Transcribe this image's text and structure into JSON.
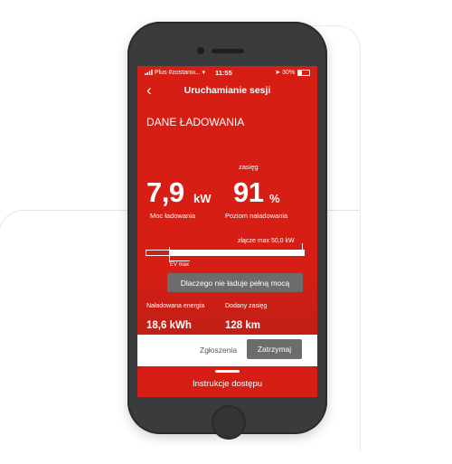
{
  "status_bar": {
    "carrier": "Plus #zostanw...",
    "time": "11:55",
    "battery": "30%"
  },
  "nav": {
    "back_icon": "chevron-left",
    "title": "Uruchamianie sesji"
  },
  "section_title": "DANE ŁADOWANIA",
  "range_header": "zasięg",
  "power": {
    "value": "7,9",
    "unit": "kW",
    "caption": "Moc ładowania"
  },
  "charge_level": {
    "value": "91",
    "unit": "%",
    "caption": "Poziom naładowania"
  },
  "connector_max": "złącze max 50,0 kW",
  "bar": {
    "progress": 0.15
  },
  "ev_max_label": "EV max",
  "why_button": "Dlaczego nie ładuje pełną mocą",
  "stats": {
    "energy_label": "Naładowana energia",
    "energy_value": "18,6 kWh",
    "range_label": "Dodany zasięg",
    "range_value": "128 km"
  },
  "bottom": {
    "reports_label": "Zgłoszenia",
    "stop_label": "Zatrzymaj"
  },
  "sheet": {
    "title": "Instrukcje dostępu"
  },
  "colors": {
    "brand_red": "#d71e15",
    "button_gray": "#6c6c6c"
  }
}
